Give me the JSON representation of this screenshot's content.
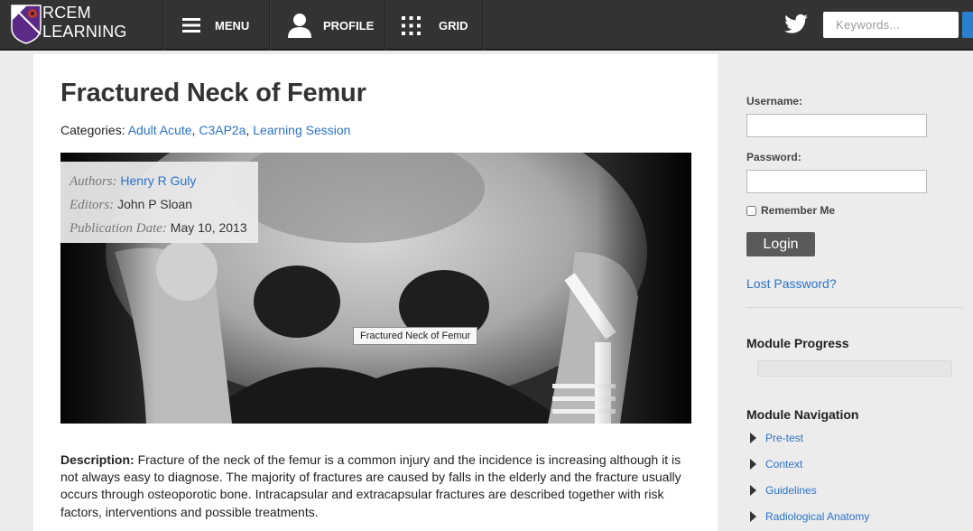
{
  "brand": {
    "line1": "RCEM",
    "line2": "LEARNING"
  },
  "nav": {
    "menu_label": "MENU",
    "profile_label": "PROFILE",
    "grid_label": "GRID"
  },
  "search": {
    "placeholder": "Keywords..."
  },
  "article": {
    "title": "Fractured Neck of Femur",
    "categories_label": "Categories:",
    "categories": [
      "Adult Acute",
      "C3AP2a",
      "Learning Session"
    ],
    "authors_label": "Authors:",
    "author": "Henry R Guly",
    "editors_label": "Editors:",
    "editor": "John P Sloan",
    "pubdate_label": "Publication Date:",
    "pubdate": "May 10, 2013",
    "image_tooltip": "Fractured Neck of Femur",
    "description_label": "Description:",
    "description": "Fracture of the neck of the femur is a common injury and the incidence is increasing although it is not always easy to diagnose. The majority of fractures are caused by falls in the elderly and the fracture usually occurs through osteoporotic bone. Intracapsular and extracapsular fractures are described together with risk factors, interventions and possible treatments."
  },
  "login": {
    "username_label": "Username:",
    "password_label": "Password:",
    "remember_label": "Remember Me",
    "button_label": "Login",
    "lost_password": "Lost Password?"
  },
  "module_progress": {
    "title": "Module Progress",
    "percent": 0
  },
  "module_navigation": {
    "title": "Module Navigation",
    "items": [
      "Pre-test",
      "Context",
      "Guidelines",
      "Radiological Anatomy"
    ]
  },
  "colors": {
    "topbar": "#333333",
    "link": "#2b72c9",
    "login_button": "#5a5a5a",
    "logo_purple": "#5b2a86"
  },
  "icons": [
    "logo-shield-icon",
    "menu-icon",
    "profile-icon",
    "grid-icon",
    "twitter-icon"
  ]
}
